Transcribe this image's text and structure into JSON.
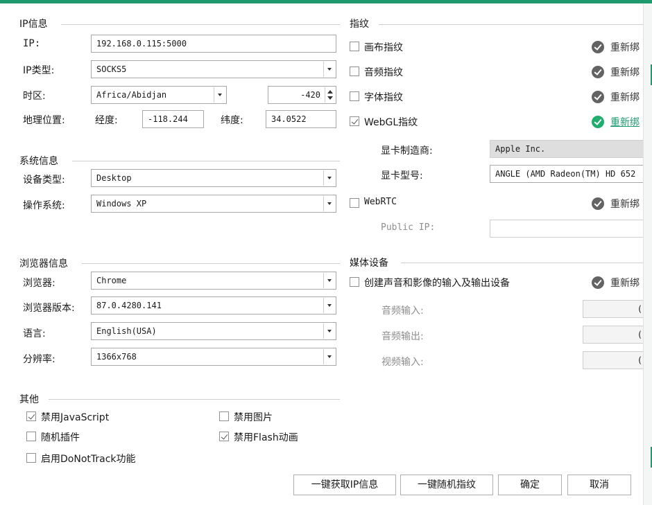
{
  "ip_section": {
    "title": "IP信息",
    "ip_label": "IP:",
    "ip_value": "192.168.0.115:5000",
    "ip_type_label": "IP类型:",
    "ip_type_value": "SOCKS5",
    "timezone_label": "时区:",
    "timezone_value": "Africa/Abidjan",
    "timezone_offset": "-420",
    "geo_label": "地理位置:",
    "longitude_label": "经度:",
    "longitude_value": "-118.244",
    "latitude_label": "纬度:",
    "latitude_value": "34.0522"
  },
  "system_section": {
    "title": "系统信息",
    "device_label": "设备类型:",
    "device_value": "Desktop",
    "os_label": "操作系统:",
    "os_value": "Windows XP"
  },
  "browser_section": {
    "title": "浏览器信息",
    "browser_label": "浏览器:",
    "browser_value": "Chrome",
    "version_label": "浏览器版本:",
    "version_value": "87.0.4280.141",
    "language_label": "语言:",
    "language_value": "English(USA)",
    "resolution_label": "分辨率:",
    "resolution_value": "1366x768"
  },
  "other_section": {
    "title": "其他",
    "disable_js": {
      "label": "禁用JavaScript",
      "checked": true
    },
    "random_plugins": {
      "label": "随机插件",
      "checked": false
    },
    "dnt": {
      "label": "启用DoNotTrack功能",
      "checked": false
    },
    "disable_images": {
      "label": "禁用图片",
      "checked": false
    },
    "disable_flash": {
      "label": "禁用Flash动画",
      "checked": true
    }
  },
  "fingerprint_section": {
    "title": "指纹",
    "canvas": {
      "label": "画布指纹",
      "checked": false,
      "action": "重新绑"
    },
    "audio": {
      "label": "音频指纹",
      "checked": false,
      "action": "重新绑"
    },
    "font": {
      "label": "字体指纹",
      "checked": false,
      "action": "重新绑"
    },
    "webgl": {
      "label": "WebGL指纹",
      "checked": true,
      "action": "重新绑"
    },
    "gpu_vendor_label": "显卡制造商:",
    "gpu_vendor_value": "Apple Inc.",
    "gpu_model_label": "显卡型号:",
    "gpu_model_value": "ANGLE (AMD Radeon(TM) HD 652",
    "webrtc": {
      "label": "WebRTC",
      "checked": false,
      "action": "重新绑"
    },
    "public_ip_label": "Public IP:",
    "public_ip_value": ""
  },
  "media_section": {
    "title": "媒体设备",
    "create_devices": {
      "label": "创建声音和影像的输入及输出设备",
      "checked": false,
      "action": "重新绑"
    },
    "audio_in_label": "音频输入:",
    "audio_in_value": "(",
    "audio_out_label": "音频输出:",
    "audio_out_value": "(",
    "video_in_label": "视频输入:",
    "video_in_value": "("
  },
  "buttons": {
    "fetch_ip": "一键获取IP信息",
    "random_fp": "一键随机指纹",
    "ok": "确定",
    "cancel": "取消"
  },
  "colors": {
    "accent": "#1f9a6e",
    "active_icon": "#1fae6e",
    "inactive_icon": "#636363"
  }
}
